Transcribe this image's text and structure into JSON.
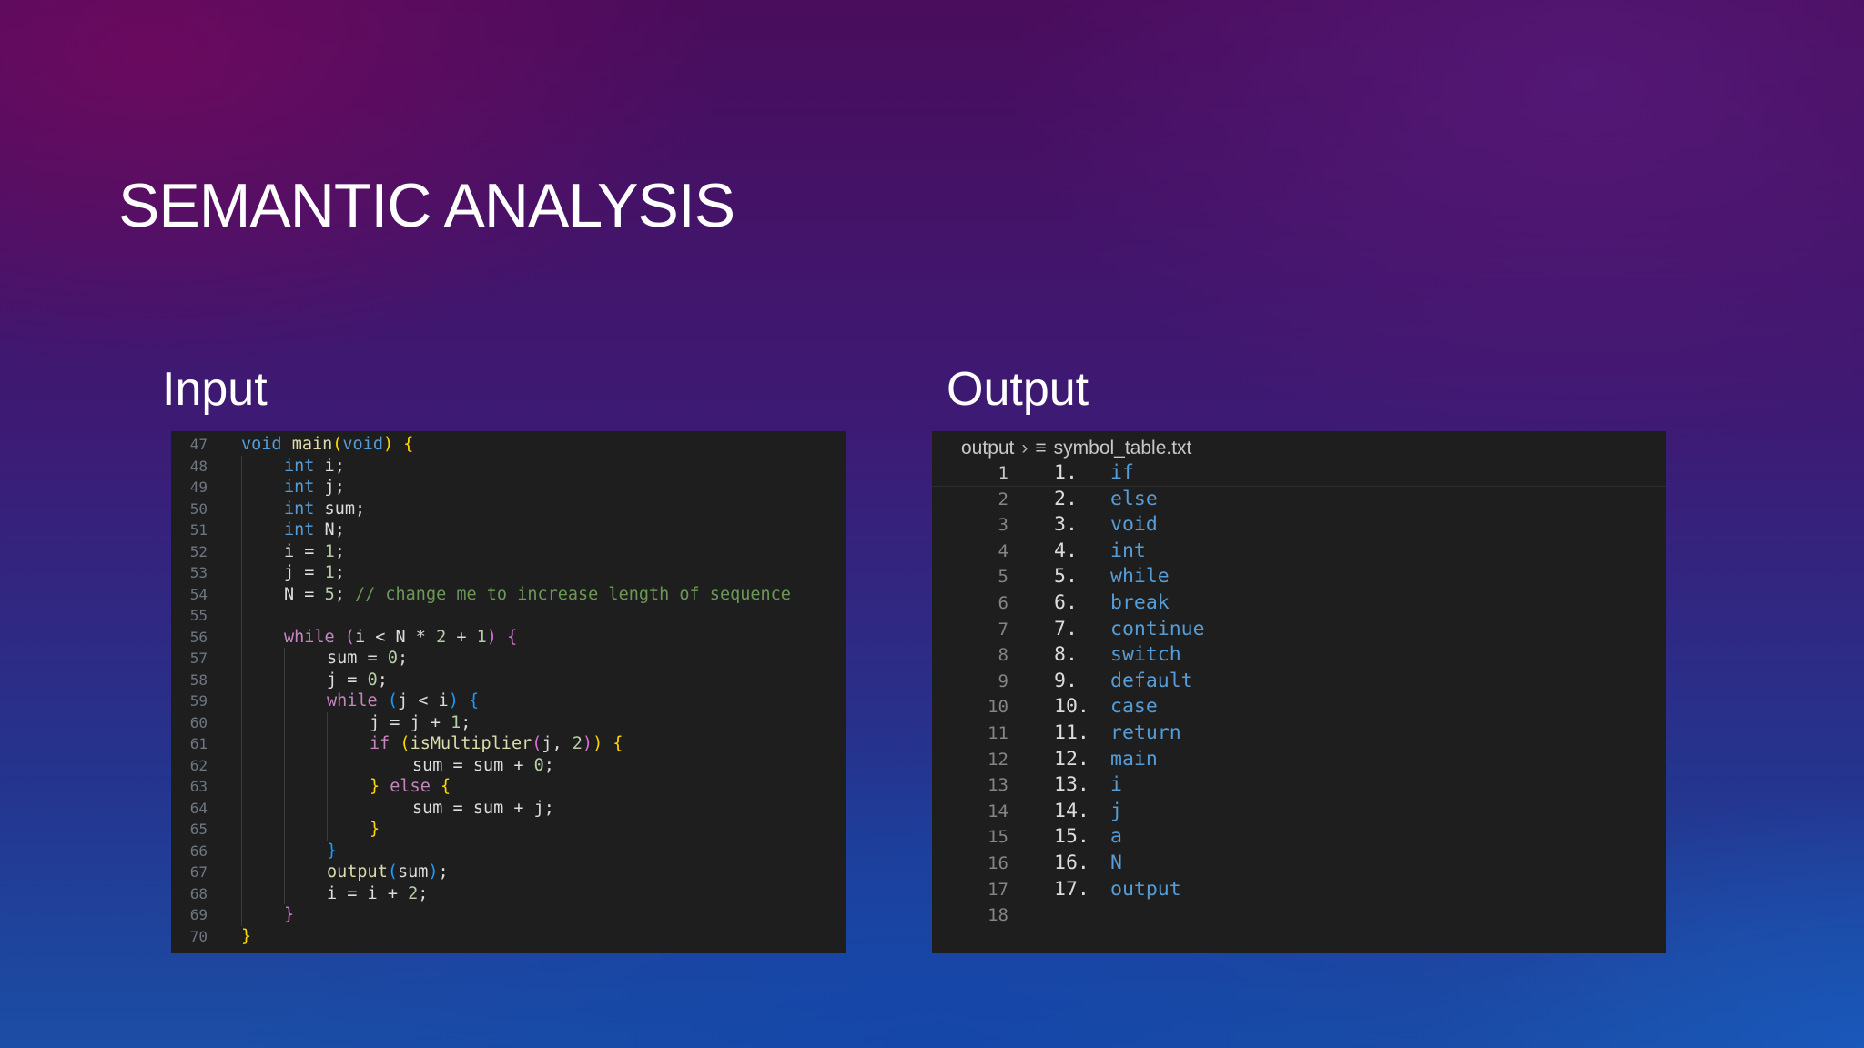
{
  "slide": {
    "title": "SEMANTIC ANALYSIS",
    "input_label": "Input",
    "output_label": "Output"
  },
  "editor": {
    "breadcrumb_folder": "output",
    "breadcrumb_file": "symbol_table.txt",
    "file_icon": "lines-icon"
  },
  "input_code": [
    {
      "ln": "47",
      "indent": 0,
      "tokens": [
        [
          "kw",
          "void"
        ],
        [
          "",
          " "
        ],
        [
          "fn",
          "main"
        ],
        [
          "p1",
          "("
        ],
        [
          "kw",
          "void"
        ],
        [
          "p1",
          ")"
        ],
        [
          "",
          " "
        ],
        [
          "p1",
          "{"
        ]
      ]
    },
    {
      "ln": "48",
      "indent": 1,
      "tokens": [
        [
          "kw",
          "int"
        ],
        [
          "",
          " i;"
        ]
      ]
    },
    {
      "ln": "49",
      "indent": 1,
      "tokens": [
        [
          "kw",
          "int"
        ],
        [
          "",
          " j;"
        ]
      ]
    },
    {
      "ln": "50",
      "indent": 1,
      "tokens": [
        [
          "kw",
          "int"
        ],
        [
          "",
          " sum;"
        ]
      ]
    },
    {
      "ln": "51",
      "indent": 1,
      "tokens": [
        [
          "kw",
          "int"
        ],
        [
          "",
          " N;"
        ]
      ]
    },
    {
      "ln": "52",
      "indent": 1,
      "tokens": [
        [
          "",
          "i = "
        ],
        [
          "nm",
          "1"
        ],
        [
          "",
          ";"
        ]
      ]
    },
    {
      "ln": "53",
      "indent": 1,
      "tokens": [
        [
          "",
          "j = "
        ],
        [
          "nm",
          "1"
        ],
        [
          "",
          ";"
        ]
      ]
    },
    {
      "ln": "54",
      "indent": 1,
      "tokens": [
        [
          "",
          "N = "
        ],
        [
          "nm",
          "5"
        ],
        [
          "",
          "; "
        ],
        [
          "cm",
          "// change me to increase length of sequence"
        ]
      ]
    },
    {
      "ln": "55",
      "indent": 1,
      "tokens": []
    },
    {
      "ln": "56",
      "indent": 1,
      "tokens": [
        [
          "ctl",
          "while"
        ],
        [
          "",
          " "
        ],
        [
          "p2",
          "("
        ],
        [
          "",
          "i < N * "
        ],
        [
          "nm",
          "2"
        ],
        [
          "",
          " + "
        ],
        [
          "nm",
          "1"
        ],
        [
          "p2",
          ")"
        ],
        [
          "",
          " "
        ],
        [
          "p2",
          "{"
        ]
      ]
    },
    {
      "ln": "57",
      "indent": 2,
      "tokens": [
        [
          "",
          "sum = "
        ],
        [
          "nm",
          "0"
        ],
        [
          "",
          ";"
        ]
      ]
    },
    {
      "ln": "58",
      "indent": 2,
      "tokens": [
        [
          "",
          "j = "
        ],
        [
          "nm",
          "0"
        ],
        [
          "",
          ";"
        ]
      ]
    },
    {
      "ln": "59",
      "indent": 2,
      "tokens": [
        [
          "ctl",
          "while"
        ],
        [
          "",
          " "
        ],
        [
          "p3",
          "("
        ],
        [
          "",
          "j < i"
        ],
        [
          "p3",
          ")"
        ],
        [
          "",
          " "
        ],
        [
          "p3",
          "{"
        ]
      ]
    },
    {
      "ln": "60",
      "indent": 3,
      "tokens": [
        [
          "",
          "j = j + "
        ],
        [
          "nm",
          "1"
        ],
        [
          "",
          ";"
        ]
      ]
    },
    {
      "ln": "61",
      "indent": 3,
      "tokens": [
        [
          "ctl",
          "if"
        ],
        [
          "",
          " "
        ],
        [
          "p1",
          "("
        ],
        [
          "fn",
          "isMultiplier"
        ],
        [
          "p2",
          "("
        ],
        [
          "",
          "j, "
        ],
        [
          "nm",
          "2"
        ],
        [
          "p2",
          ")"
        ],
        [
          "p1",
          ")"
        ],
        [
          "",
          " "
        ],
        [
          "p1",
          "{"
        ]
      ]
    },
    {
      "ln": "62",
      "indent": 4,
      "tokens": [
        [
          "",
          "sum = sum + "
        ],
        [
          "nm",
          "0"
        ],
        [
          "",
          ";"
        ]
      ]
    },
    {
      "ln": "63",
      "indent": 3,
      "tokens": [
        [
          "p1",
          "}"
        ],
        [
          "",
          " "
        ],
        [
          "ctl",
          "else"
        ],
        [
          "",
          " "
        ],
        [
          "p1",
          "{"
        ]
      ]
    },
    {
      "ln": "64",
      "indent": 4,
      "tokens": [
        [
          "",
          "sum = sum + j;"
        ]
      ]
    },
    {
      "ln": "65",
      "indent": 3,
      "tokens": [
        [
          "p1",
          "}"
        ]
      ]
    },
    {
      "ln": "66",
      "indent": 2,
      "tokens": [
        [
          "p3",
          "}"
        ]
      ]
    },
    {
      "ln": "67",
      "indent": 2,
      "tokens": [
        [
          "fn",
          "output"
        ],
        [
          "p3",
          "("
        ],
        [
          "",
          "sum"
        ],
        [
          "p3",
          ")"
        ],
        [
          "",
          ";"
        ]
      ]
    },
    {
      "ln": "68",
      "indent": 2,
      "tokens": [
        [
          "",
          "i = i + "
        ],
        [
          "nm",
          "2"
        ],
        [
          "",
          ";"
        ]
      ]
    },
    {
      "ln": "69",
      "indent": 1,
      "tokens": [
        [
          "p2",
          "}"
        ]
      ]
    },
    {
      "ln": "70",
      "indent": 0,
      "tokens": [
        [
          "p1",
          "}"
        ]
      ]
    }
  ],
  "symbol_table": [
    {
      "ln": "1",
      "num": "1.",
      "name": "if"
    },
    {
      "ln": "2",
      "num": "2.",
      "name": "else"
    },
    {
      "ln": "3",
      "num": "3.",
      "name": "void"
    },
    {
      "ln": "4",
      "num": "4.",
      "name": "int"
    },
    {
      "ln": "5",
      "num": "5.",
      "name": "while"
    },
    {
      "ln": "6",
      "num": "6.",
      "name": "break"
    },
    {
      "ln": "7",
      "num": "7.",
      "name": "continue"
    },
    {
      "ln": "8",
      "num": "8.",
      "name": "switch"
    },
    {
      "ln": "9",
      "num": "9.",
      "name": "default"
    },
    {
      "ln": "10",
      "num": "10.",
      "name": "case"
    },
    {
      "ln": "11",
      "num": "11.",
      "name": "return"
    },
    {
      "ln": "12",
      "num": "12.",
      "name": "main"
    },
    {
      "ln": "13",
      "num": "13.",
      "name": "i"
    },
    {
      "ln": "14",
      "num": "14.",
      "name": "j"
    },
    {
      "ln": "15",
      "num": "15.",
      "name": "a"
    },
    {
      "ln": "16",
      "num": "16.",
      "name": "N"
    },
    {
      "ln": "17",
      "num": "17.",
      "name": "output"
    },
    {
      "ln": "18",
      "num": "",
      "name": ""
    }
  ]
}
